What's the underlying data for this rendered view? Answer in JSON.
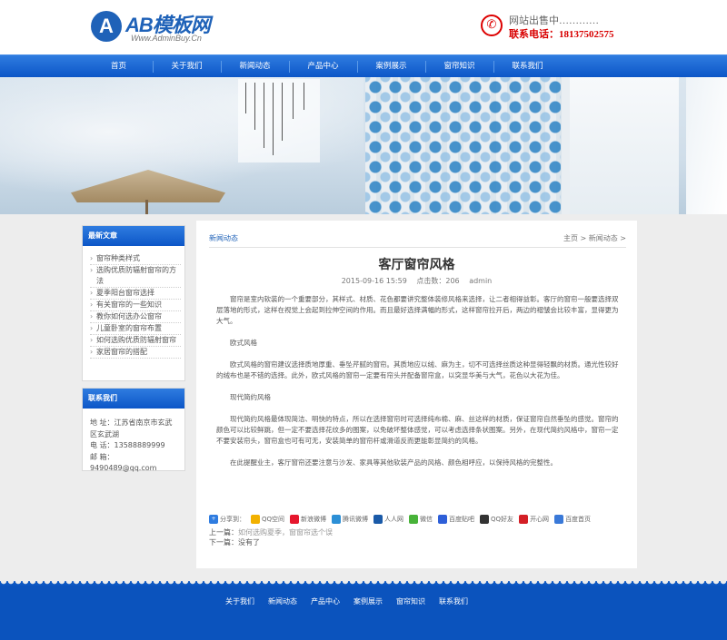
{
  "header": {
    "logo_mark": "A",
    "logo_text": "AB模板网",
    "logo_url": "Www.AdminBuy.Cn",
    "sale_text": "网站出售中…………",
    "tel_text": "联系电话：18137502575",
    "phone_icon": "phone-icon"
  },
  "nav": {
    "items": [
      "首页",
      "关于我们",
      "新闻动态",
      "产品中心",
      "案例展示",
      "窗帘知识",
      "联系我们"
    ]
  },
  "sidebar": {
    "news_title": "最新文章",
    "news_items": [
      "窗帘种类样式",
      "选购优质防辐射窗帘的方法",
      "夏季阳台窗帘选择",
      "有关窗帘的一些知识",
      "教你如何选办公窗帘",
      "儿童卧室的窗帘布置",
      "如何选购优质防辐射窗帘",
      "家居窗帘的搭配"
    ],
    "contact_title": "联系我们",
    "contact_lines": [
      "地 址：江苏省南京市玄武区玄武湖",
      "电 话：13588889999",
      "邮 箱：9490489@qq.com"
    ]
  },
  "main": {
    "tab_label": "新闻动态",
    "breadcrumb": "主页 > 新闻动态 >",
    "title": "客厅窗帘风格",
    "date": "2015-09-16 15:59",
    "hits": "点击数：206",
    "author": "admin",
    "paragraphs": [
      "窗帘是室内软装的一个重要部分，其样式、材质、花色都要讲究整体装修风格来选择，让二者相得益彰。客厅的窗帘一般要选择双层落地的形式，这样在视觉上会起到拉伸空间的作用。而且最好选择满幅的形式，这样窗帘拉开后，两边的褶皱会比较丰富，显得更为大气。",
      "欧式风格",
      "欧式风格的窗帘建议选择质地厚重、垂坠芹腻的窗帘。其质地应以绒、麻为主，切不可选择丝质这种显得轻飘的材质。通光性较好的绒布也是不错的选择。此外，欧式风格的窗帘一定要有帘头并配备窗帘盒，以突显华美与大气，花色以大花为佳。",
      "现代简约风格",
      "现代简约风格最体现简洁、明快的特点，所以在选择窗帘时可选择纯布棉、麻、丝这样的材质，保证窗帘自然垂坠的感觉。窗帘的颜色可以比较鲜跳，但一定不要选择花纹多的图案，以免破坏整体感觉，可以考虑选择条状图案。另外，在现代简约风格中，窗帘一定不要安装帘头，窗帘盒也可有可无，安装简单的窗帘杆或滑道反而更能彰显简约的风格。",
      "在此提醒业主，客厅窗帘还要注意与沙发、家具等其他软装产品的风格、颜色相呼应，以保持风格的完整性。"
    ],
    "share": {
      "label": "分享到：",
      "items": [
        {
          "name": "QQ空间",
          "color": "#f2b100"
        },
        {
          "name": "新浪微博",
          "color": "#e6162d"
        },
        {
          "name": "腾讯微博",
          "color": "#2c8fd6"
        },
        {
          "name": "人人网",
          "color": "#1a5aa8"
        },
        {
          "name": "微信",
          "color": "#48b339"
        },
        {
          "name": "百度贴吧",
          "color": "#2e5fd8"
        },
        {
          "name": "QQ好友",
          "color": "#333333"
        },
        {
          "name": "开心网",
          "color": "#d41f26"
        },
        {
          "name": "百度首页",
          "color": "#3a79d8"
        }
      ]
    },
    "prev_label": "上一篇：",
    "prev_title": "如何选购夏季，窗窗帘选个误",
    "next_label": "下一篇：",
    "next_title": "没有了"
  },
  "footer": {
    "links": [
      "关于我们",
      "新闻动态",
      "产品中心",
      "案例展示",
      "窗帘知识",
      "联系我们"
    ]
  },
  "colors": {
    "brand_blue": "#1f62b8",
    "nav_blue": "#0c56c7",
    "tel_red": "#d80000"
  }
}
